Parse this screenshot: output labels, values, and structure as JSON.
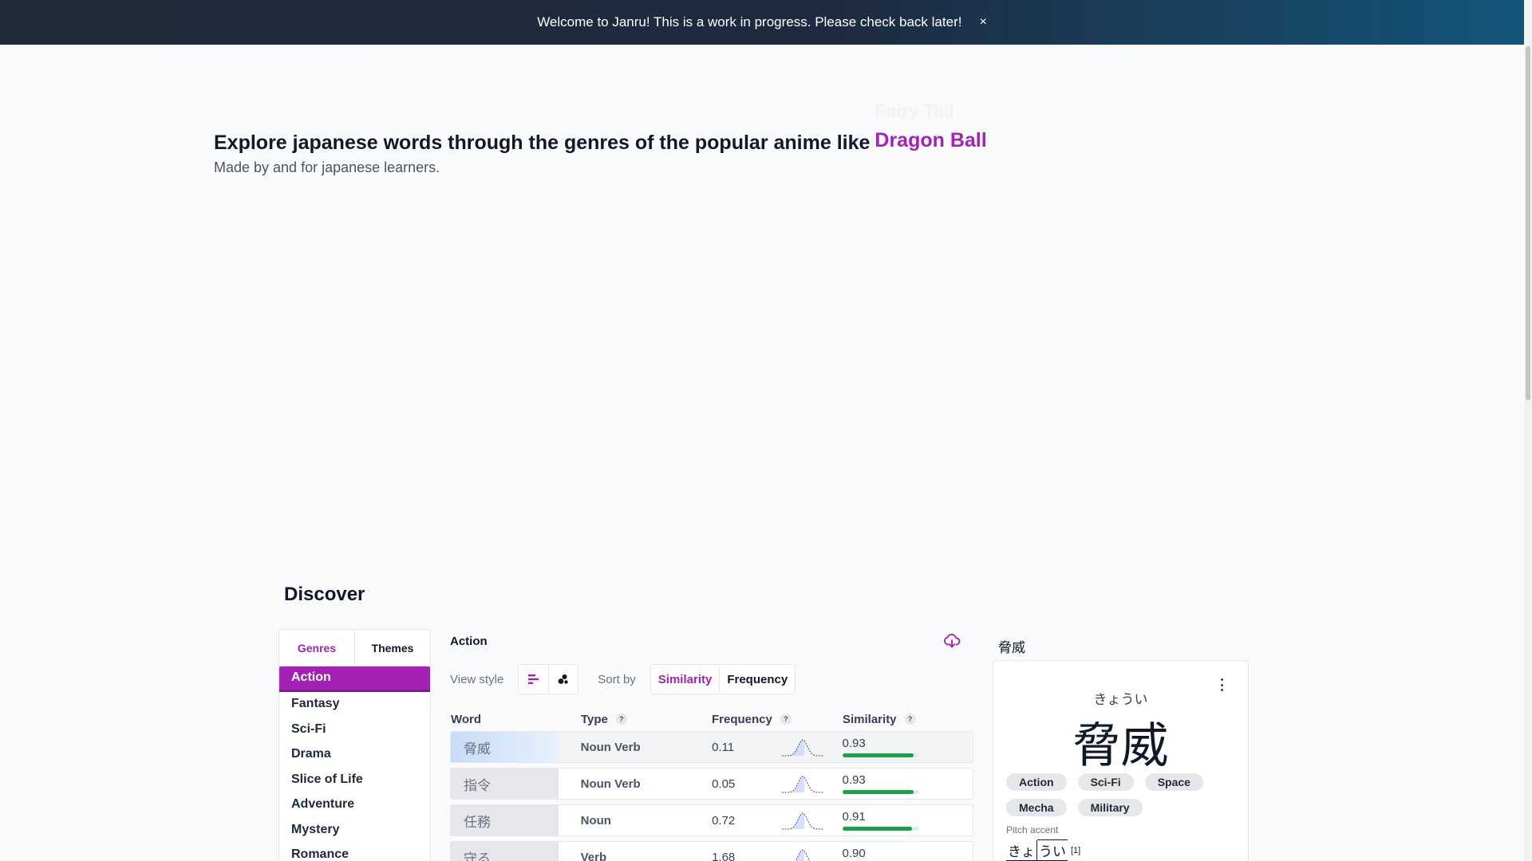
{
  "banner": {
    "message": "Welcome to Janru! This is a work in progress. Please check back later!",
    "close": "×"
  },
  "hero": {
    "title": "Explore japanese words through the genres of the popular anime like",
    "previous_anime": "Fairy Tail",
    "current_anime": "Dragon Ball",
    "subtitle": "Made by and for japanese learners."
  },
  "discover": {
    "title": "Discover",
    "tabs": [
      {
        "label": "Genres",
        "active": true
      },
      {
        "label": "Themes",
        "active": false
      }
    ],
    "genres": [
      "Action",
      "Fantasy",
      "Sci-Fi",
      "Drama",
      "Slice of Life",
      "Adventure",
      "Mystery",
      "Romance"
    ],
    "selected_genre": "Action"
  },
  "list": {
    "heading": "Action",
    "download_icon": "cloud-download-icon",
    "view_style_label": "View style",
    "view_buttons": [
      {
        "icon": "bar-list-icon",
        "active": true
      },
      {
        "icon": "bubble-icon",
        "active": false
      }
    ],
    "sort_label": "Sort by",
    "sort_options": [
      {
        "label": "Similarity",
        "active": true
      },
      {
        "label": "Frequency",
        "active": false
      }
    ],
    "columns": {
      "word": "Word",
      "type": "Type",
      "frequency": "Frequency",
      "similarity": "Similarity",
      "help": "?"
    },
    "rows": [
      {
        "word": "脅威",
        "type": "Noun Verb",
        "frequency": "0.11",
        "similarity": "0.93",
        "similarity_value": 0.93,
        "selected": true
      },
      {
        "word": "指令",
        "type": "Noun Verb",
        "frequency": "0.05",
        "similarity": "0.93",
        "similarity_value": 0.93,
        "selected": false
      },
      {
        "word": "任務",
        "type": "Noun",
        "frequency": "0.72",
        "similarity": "0.91",
        "similarity_value": 0.91,
        "selected": false
      },
      {
        "word": "守る",
        "type": "Verb",
        "frequency": "1.68",
        "similarity": "0.90",
        "similarity_value": 0.9,
        "selected": false
      }
    ]
  },
  "detail": {
    "title": "脅威",
    "reading": "きょうい",
    "kanji": "脅威",
    "tags": [
      "Action",
      "Sci-Fi",
      "Space",
      "Mecha",
      "Military"
    ],
    "pitch_label": "Pitch accent",
    "pitch_low": "きょ",
    "pitch_high": "うい",
    "pitch_number": "[1]"
  },
  "colors": {
    "accent": "#a321b5",
    "similarity_bar": "#16a34a",
    "banner_start": "#1f2937",
    "banner_end": "#13557a"
  }
}
